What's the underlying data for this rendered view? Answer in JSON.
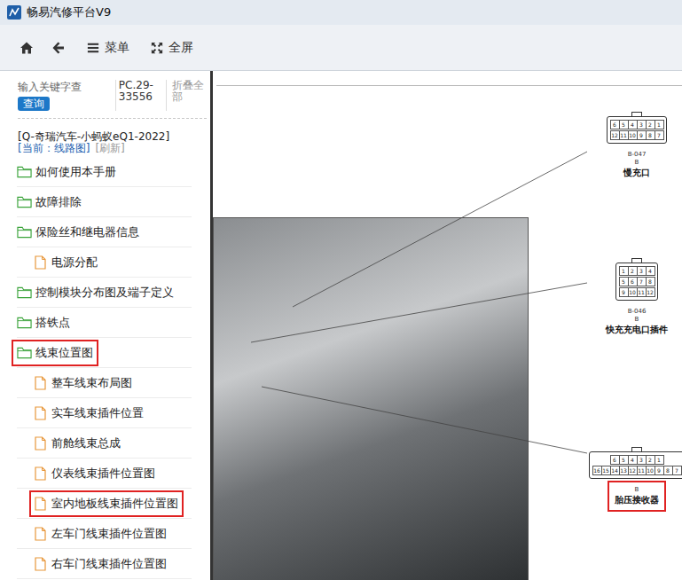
{
  "window": {
    "title": "畅易汽修平台V9"
  },
  "toolbar": {
    "buttons": [
      {
        "label": "菜单",
        "kind": "menu"
      },
      {
        "label": "全屏",
        "kind": "fullscreen"
      }
    ]
  },
  "sidebar": {
    "search": {
      "placeholder": "输入关键字查",
      "button": "查询"
    },
    "code": "PC.29-33556",
    "collapse": "折叠全部",
    "model": "[Q-奇瑞汽车-小蚂蚁eQ1-2022]",
    "current": "[当前：线路图]",
    "refresh": "[刷新]",
    "items": [
      {
        "label": "如何使用本手册",
        "kind": "folder",
        "depth": 0,
        "marked": false
      },
      {
        "label": "故障排除",
        "kind": "folder",
        "depth": 0,
        "marked": false
      },
      {
        "label": "保险丝和继电器信息",
        "kind": "folder",
        "depth": 0,
        "marked": false
      },
      {
        "label": "电源分配",
        "kind": "file",
        "depth": 1,
        "marked": false
      },
      {
        "label": "控制模块分布图及端子定义",
        "kind": "folder",
        "depth": 0,
        "marked": false
      },
      {
        "label": "搭铁点",
        "kind": "folder",
        "depth": 0,
        "marked": false
      },
      {
        "label": "线束位置图",
        "kind": "folder",
        "depth": 0,
        "marked": true
      },
      {
        "label": "整车线束布局图",
        "kind": "file",
        "depth": 1,
        "marked": false
      },
      {
        "label": "实车线束插件位置",
        "kind": "file",
        "depth": 1,
        "marked": false
      },
      {
        "label": "前舱线束总成",
        "kind": "file",
        "depth": 1,
        "marked": false
      },
      {
        "label": "仪表线束插件位置图",
        "kind": "file",
        "depth": 1,
        "marked": false
      },
      {
        "label": "室内地板线束插件位置图",
        "kind": "file",
        "depth": 1,
        "marked": true
      },
      {
        "label": "左车门线束插件位置图",
        "kind": "file",
        "depth": 1,
        "marked": false
      },
      {
        "label": "右车门线束插件位置图",
        "kind": "file",
        "depth": 1,
        "marked": false
      }
    ]
  },
  "connectors": [
    {
      "code": "B-047",
      "side": "B",
      "name": "慢充口",
      "marked": false,
      "pins": [
        [
          "6",
          "5",
          "4",
          "3",
          "2",
          "1"
        ],
        [
          "12",
          "11",
          "10",
          "9",
          "8",
          "7"
        ]
      ]
    },
    {
      "code": "B-046",
      "side": "B",
      "name": "快充充电口插件",
      "marked": false,
      "pins": [
        [
          "1",
          "2",
          "3",
          "4"
        ],
        [
          "5",
          "6",
          "7",
          "8"
        ],
        [
          "9",
          "10",
          "11",
          "12"
        ]
      ]
    },
    {
      "code": "",
      "side": "B",
      "name": "胎压接收器",
      "marked": true,
      "pins": [
        [
          "6",
          "5",
          "4",
          "3",
          "2",
          "1"
        ],
        [
          "16",
          "15",
          "14",
          "13",
          "12",
          "11",
          "10",
          "9",
          "8",
          "7"
        ]
      ]
    }
  ]
}
